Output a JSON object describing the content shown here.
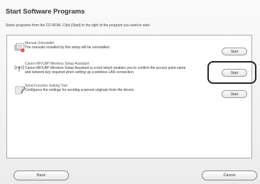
{
  "header": {
    "title": "Start Software Programs",
    "subtitle": "Starts programs from the CD-ROM. Click [Start] to the right of the program you want to start."
  },
  "programs": [
    {
      "name": "Manual Uninstaller",
      "desc1": "The manuals installed by this setup will be uninstalled.",
      "desc2": "",
      "icon": "uninstaller-icon",
      "button": "Start"
    },
    {
      "name": "Canon MF/LBP Wireless Setup Assistant",
      "desc1": "Canon MF/LBP Wireless Setup Assistant is a tool which enables you to confirm the access point name",
      "desc2": "and network key required when setting up a wireless LAN connection.",
      "icon": "wireless-icon",
      "button": "Start"
    },
    {
      "name": "Send Function Setting Tool",
      "desc1": "Configures the settings for sending scanned originals from the device.",
      "desc2": "",
      "icon": "send-setting-icon",
      "button": "Start"
    }
  ],
  "footer": {
    "back": "Back",
    "cancel": "Cancel"
  }
}
